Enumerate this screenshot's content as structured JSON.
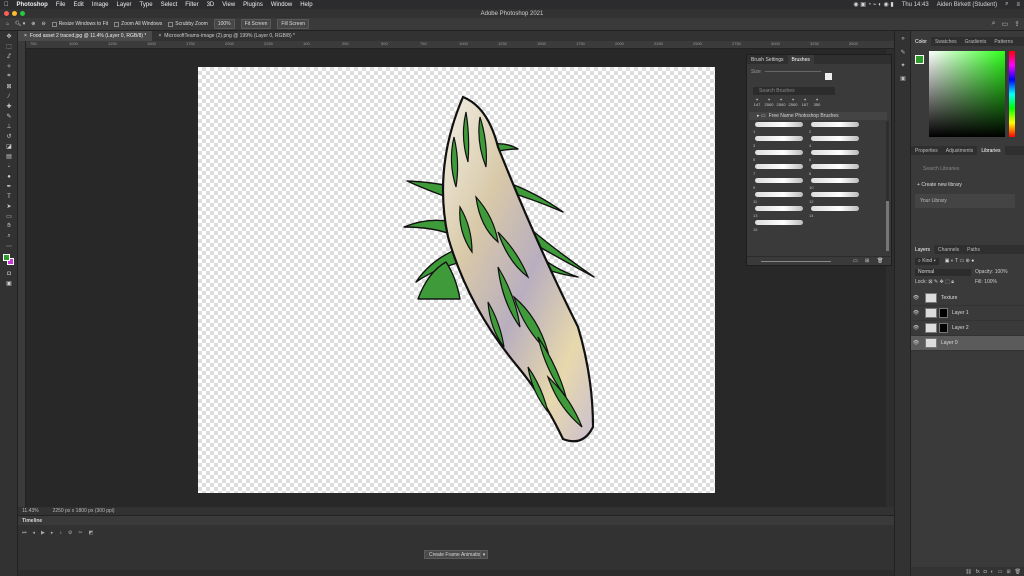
{
  "menubar": {
    "apple": "",
    "app": "Photoshop",
    "items": [
      "File",
      "Edit",
      "Image",
      "Layer",
      "Type",
      "Select",
      "Filter",
      "3D",
      "View",
      "Plugins",
      "Window",
      "Help"
    ],
    "clock": "Thu 14:43",
    "user": "Aiden Birkett (Student)"
  },
  "window": {
    "title": "Adobe Photoshop 2021"
  },
  "options": {
    "resize_windows": "Resize Windows to Fit",
    "zoom_all": "Zoom All Windows",
    "scrubby_zoom": "Scrubby Zoom",
    "zoom_level": "100%",
    "fit_screen": "Fit Screen",
    "fill_screen": "Fill Screen"
  },
  "tabs": [
    {
      "label": "Food asset 2 traced.jpg @ 11.4% (Layer 0, RGB/8) *"
    },
    {
      "label": "MicrosoftTeams-image (2).png @ 199% (Layer 0, RGB/8) *"
    }
  ],
  "ruler": {
    "ticks": [
      "750",
      "1000",
      "1250",
      "1500",
      "1750",
      "2000",
      "2250",
      "100",
      "250",
      "500",
      "750",
      "1000",
      "1250",
      "1500",
      "1750",
      "2000",
      "2250",
      "2500",
      "2750",
      "3000",
      "3250",
      "3500"
    ]
  },
  "status": {
    "zoom": "11.43%",
    "dimensions": "2250 px x 1800 px (300 ppi)"
  },
  "timeline": {
    "title": "Timeline",
    "create_frame": "Create Frame Animation"
  },
  "brushes": {
    "tabs": [
      "Brush Settings",
      "Brushes"
    ],
    "size_label": "Size",
    "search_placeholder": "Search Brushes",
    "presets": [
      "147",
      "2500",
      "2500",
      "2500",
      "167",
      "350"
    ],
    "group_name": "Free Name Photoshop Brushes",
    "brush_numbers": [
      "1",
      "2",
      "3",
      "4",
      "5",
      "6",
      "7",
      "8",
      "9",
      "10",
      "11",
      "12",
      "13",
      "14",
      "15"
    ]
  },
  "color_panel": {
    "tabs": [
      "Color",
      "Swatches",
      "Gradients",
      "Patterns"
    ],
    "foreground": "#2d9a2a",
    "background": "#c83ad4"
  },
  "libraries_panel": {
    "tabs": [
      "Properties",
      "Adjustments",
      "Libraries"
    ],
    "search_placeholder": "Search Libraries",
    "create_new": "Create new library",
    "library_name": "Your Library"
  },
  "layers_panel": {
    "tabs": [
      "Layers",
      "Channels",
      "Paths"
    ],
    "filter_kind": "Kind",
    "blend_mode": "Normal",
    "opacity_label": "Opacity:",
    "opacity_value": "100%",
    "lock_label": "Lock:",
    "fill_label": "Fill:",
    "fill_value": "100%",
    "layers": [
      {
        "name": "Texture",
        "has_mask": false,
        "selected": false
      },
      {
        "name": "Layer 1",
        "has_mask": true,
        "selected": false
      },
      {
        "name": "Layer 2",
        "has_mask": true,
        "selected": false
      },
      {
        "name": "Layer 0",
        "has_mask": false,
        "selected": true
      }
    ]
  }
}
